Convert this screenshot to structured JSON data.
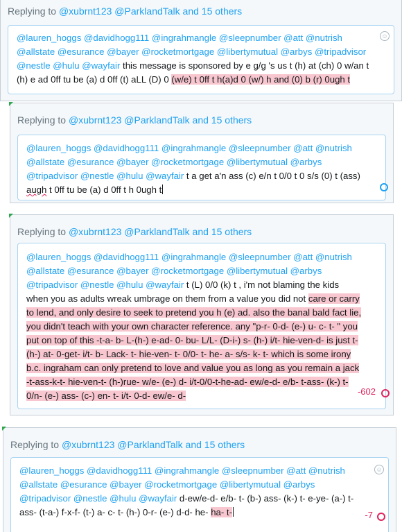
{
  "reply_prefix": "Replying to",
  "reply_handles": "@xubrnt123 @ParklandTalk and 15 others",
  "mention_block": "@lauren_hoggs @davidhogg111 @ingrahmangle @sleepnumber @att @nutrish @allstate @esurance @bayer @rocketmortgage @libertymutual @arbys @tripadvisor @nestle @hulu @wayfair",
  "panels": [
    {
      "text_plain": " this message is sponsored by e g/g 's us t (h) at (ch) 0 w/an t (h) e ad 0ff tu be (a) d 0ff (t) aLL (D) 0 ",
      "text_highlight": "(w/e) t 0ff t h(a)d 0 (w/) h and (0) b (r) 0ugh t"
    },
    {
      "text_plain": " t a get a'n ass (c) e/n t 0/0 t 0 s/s (0) t (ass) ",
      "text_squiggle": "augh",
      "text_plain_2": " t 0ff tu be (a) d 0ff t h 0ugh t"
    },
    {
      "text_plain": "  t (L) 0/0 (k) t , i'm not blaming the kids when you as adults wreak umbrage on them from a value you did not ",
      "text_highlight_1": "care or carry to lend, and only desire to seek to pretend you h (e) ad. also the banal bald fact lie, you didn't teach with your own character reference.  any \"p-r- 0-d- (e-) u- c- t- \"  you put on top of this -t-a- b- L-(h-) e-ad- 0- bu- L/L- (D-i-) s- (h-) i/t- hie-ven-d-  is just t- (h-) at-  0-get- i/t- b- Lack- t- hie-ven- t- 0/0- t- he- a- s/s- k- t-  which is some irony b.c. ingraham can only pretend to love and value you as long as you remain a jack -t-ass-k-t- hie-ven-t- (h-)rue- w/e- (e-) d- i/t-0/0-t-he-ad- ew/e-d-  e/b- t-ass- (k-) t- 0/n- (e-) ass- (c-) en- t- i/t- 0-d- ew/e- d-",
      "counter": "-602"
    },
    {
      "text_plain": "  d-ew/e-d- e/b- t- (b-) ass- (k-) t- e-ye- (a-) t- ass- (t-a-) f-x-f- (t-) a- c- t-  (h-) 0-r- (e-) d-d- he- ",
      "text_highlight": "ha- t-",
      "counter": "-7"
    }
  ]
}
